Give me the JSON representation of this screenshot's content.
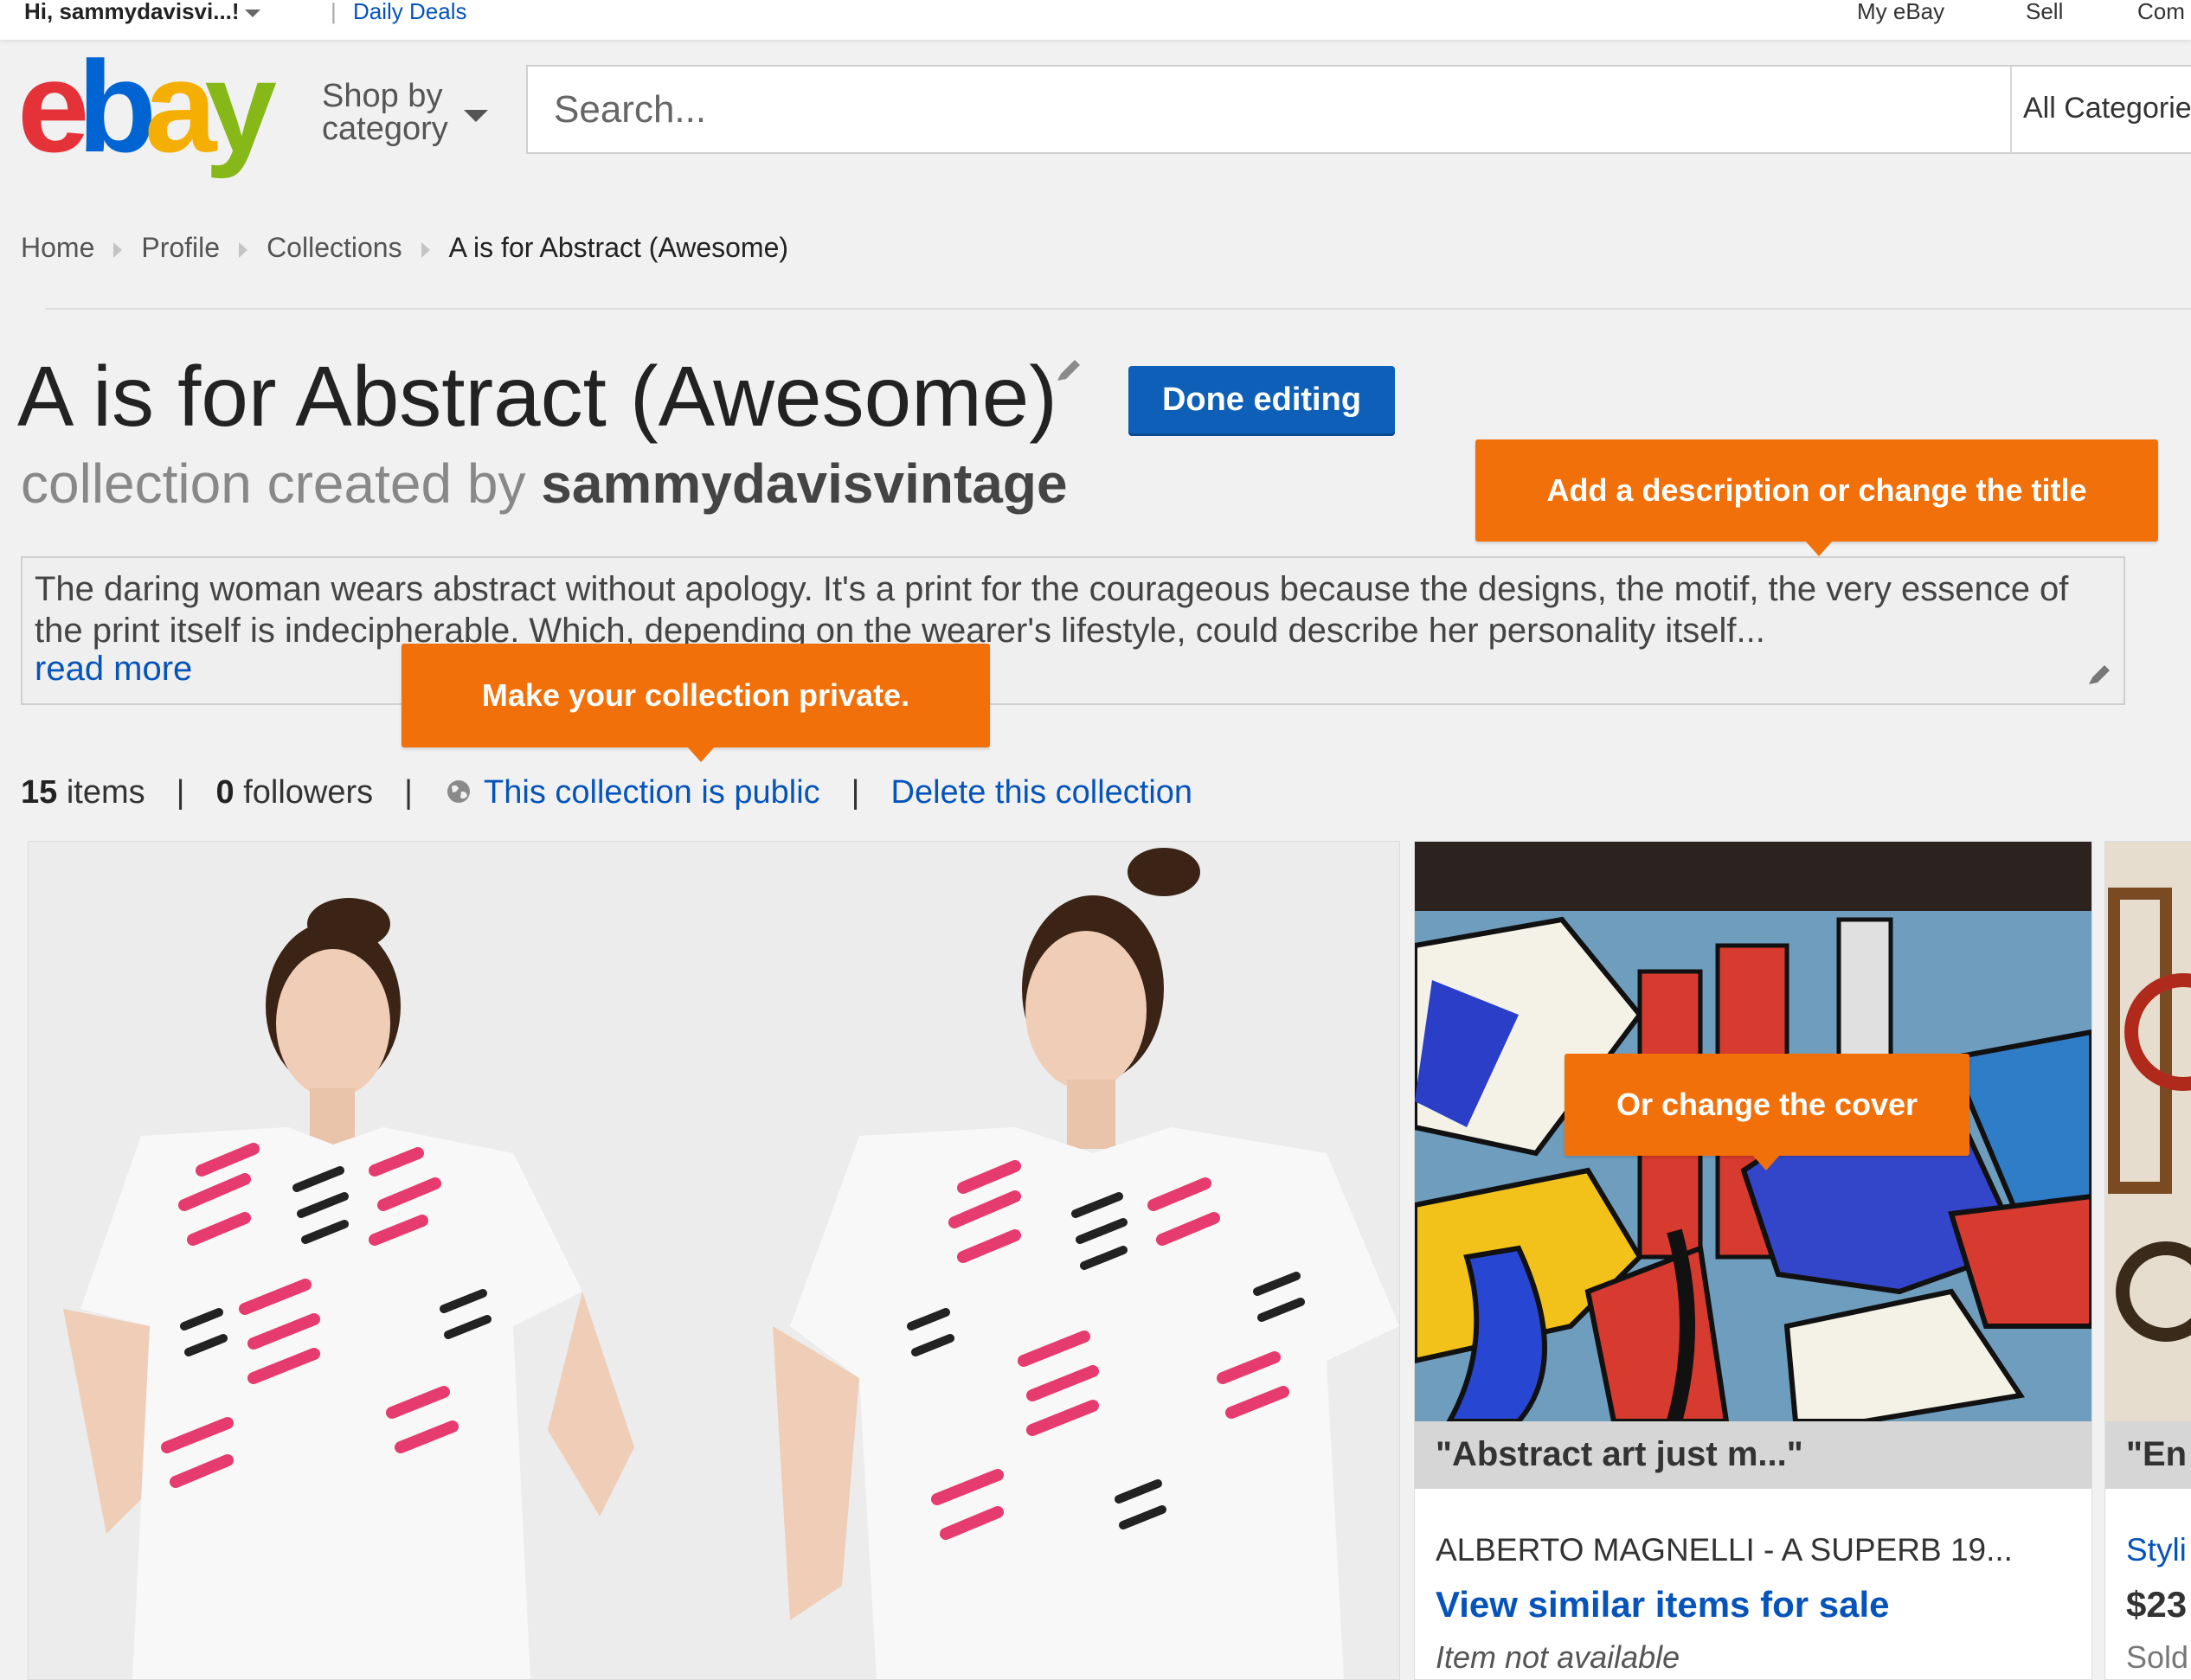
{
  "topbar": {
    "greeting": "Hi, sammydavisvi...!",
    "daily_deals": "Daily Deals",
    "my_ebay": "My eBay",
    "sell": "Sell",
    "community": "Com"
  },
  "header": {
    "logo": {
      "e": "e",
      "b": "b",
      "a": "a",
      "y": "y"
    },
    "shop_by_line1": "Shop by",
    "shop_by_line2": "category",
    "search_placeholder": "Search...",
    "category_select": "All Categories"
  },
  "breadcrumb": [
    "Home",
    "Profile",
    "Collections",
    "A is for Abstract (Awesome)"
  ],
  "collection": {
    "title": "A is for Abstract (Awesome)",
    "created_by_prefix": "collection created by",
    "owner": "sammydavisvintage",
    "done_button": "Done editing",
    "description": "The daring woman wears abstract without apology. It's a print for the courageous because the designs, the motif, the very essence of the print itself is indecipherable. Which, depending on the wearer's lifestyle, could describe her personality itself...",
    "read_more": "read more",
    "items_count": "15",
    "items_label": "items",
    "followers_count": "0",
    "followers_label": "followers",
    "public_link": "This collection is public",
    "delete_link": "Delete this collection"
  },
  "tooltips": {
    "description": "Add a description or change the title",
    "private": "Make your collection private.",
    "cover": "Or change the cover"
  },
  "cards": [
    {
      "caption": "\"Abstract art just m...\"",
      "title": "ALBERTO MAGNELLI - A SUPERB 19...",
      "link": "View similar items for sale",
      "status": "Item not available"
    },
    {
      "caption": "\"En",
      "title": "Styli",
      "price": "$23",
      "status": "Sold"
    }
  ],
  "colors": {
    "accent_blue": "#0654ba",
    "tooltip_orange": "#f2700a",
    "button_blue": "#0d5fb8"
  }
}
